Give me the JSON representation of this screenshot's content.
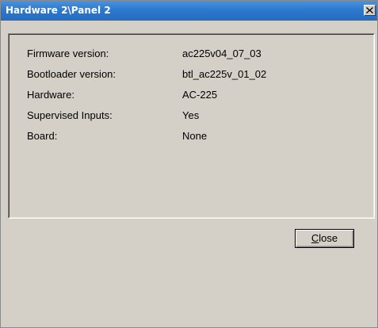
{
  "window": {
    "title": "Hardware 2\\Panel 2"
  },
  "info": {
    "rows": [
      {
        "label": "Firmware version:",
        "value": "ac225v04_07_03"
      },
      {
        "label": "Bootloader version:",
        "value": "btl_ac225v_01_02"
      },
      {
        "label": "Hardware:",
        "value": "AC-225"
      },
      {
        "label": "Supervised Inputs:",
        "value": "Yes"
      },
      {
        "label": "Board:",
        "value": "None"
      }
    ]
  },
  "buttons": {
    "close_mnemonic": "C",
    "close_rest": "lose"
  },
  "colors": {
    "titlebar": "#2d79cd",
    "dialog_background": "#d4d0c8"
  },
  "icons": {
    "title_close": "close-icon"
  }
}
